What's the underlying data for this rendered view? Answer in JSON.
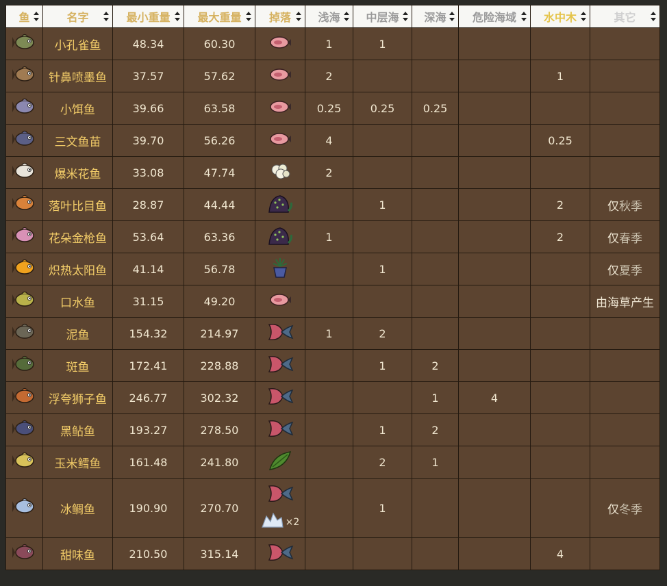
{
  "colors": {
    "row_bg": "#5c4430",
    "header_bg": "#f7f7f4",
    "name_text": "#f2cc68",
    "grid": "#241a10"
  },
  "headers": [
    {
      "label": "鱼"
    },
    {
      "label": "名字"
    },
    {
      "label": "最小重量"
    },
    {
      "label": "最大重量"
    },
    {
      "label": "掉落"
    },
    {
      "label": "浅海"
    },
    {
      "label": "中层海"
    },
    {
      "label": "深海"
    },
    {
      "label": "危险海域"
    },
    {
      "label": "水中木"
    },
    {
      "label": "其它"
    }
  ],
  "rows": [
    {
      "icon": "fish-icon",
      "fish_color": "#7d8a55",
      "name": "小孔雀鱼",
      "min": "48.34",
      "max": "60.30",
      "loot": "small-meat-icon",
      "loot_extra": "",
      "shallow": "1",
      "mid": "1",
      "deep": "",
      "danger": "",
      "tree": "",
      "note_a": "",
      "note_b": ""
    },
    {
      "icon": "fish-icon",
      "fish_color": "#a07b52",
      "name": "针鼻喷墨鱼",
      "min": "37.57",
      "max": "57.62",
      "loot": "small-meat-icon",
      "loot_extra": "",
      "shallow": "2",
      "mid": "",
      "deep": "",
      "danger": "",
      "tree": "1",
      "note_a": "",
      "note_b": ""
    },
    {
      "icon": "fish-icon",
      "fish_color": "#8b88b0",
      "name": "小饵鱼",
      "min": "39.66",
      "max": "63.58",
      "loot": "small-meat-icon",
      "loot_extra": "",
      "shallow": "0.25",
      "mid": "0.25",
      "deep": "0.25",
      "danger": "",
      "tree": "",
      "note_a": "",
      "note_b": ""
    },
    {
      "icon": "fish-icon",
      "fish_color": "#5b5f86",
      "name": "三文鱼苗",
      "min": "39.70",
      "max": "56.26",
      "loot": "small-meat-icon",
      "loot_extra": "",
      "shallow": "4",
      "mid": "",
      "deep": "",
      "danger": "",
      "tree": "0.25",
      "note_a": "",
      "note_b": ""
    },
    {
      "icon": "fish-icon",
      "fish_color": "#e8e4da",
      "name": "爆米花鱼",
      "min": "33.08",
      "max": "47.74",
      "loot": "popcorn-icon",
      "loot_extra": "",
      "shallow": "2",
      "mid": "",
      "deep": "",
      "danger": "",
      "tree": "",
      "note_a": "",
      "note_b": ""
    },
    {
      "icon": "fish-icon",
      "fish_color": "#d9823a",
      "name": "落叶比目鱼",
      "min": "28.87",
      "max": "44.44",
      "loot": "berry-bush-icon",
      "loot_extra": "",
      "shallow": "",
      "mid": "1",
      "deep": "",
      "danger": "",
      "tree": "2",
      "note_a": "仅",
      "note_b": "秋季"
    },
    {
      "icon": "fish-icon",
      "fish_color": "#d891b6",
      "name": "花朵金枪鱼",
      "min": "53.64",
      "max": "63.36",
      "loot": "berry-bush-icon",
      "loot_extra": "",
      "shallow": "1",
      "mid": "",
      "deep": "",
      "danger": "",
      "tree": "2",
      "note_a": "仅",
      "note_b": "春季"
    },
    {
      "icon": "fish-icon",
      "fish_color": "#f0a21e",
      "name": "炽热太阳鱼",
      "min": "41.14",
      "max": "56.78",
      "loot": "potted-plant-icon",
      "loot_extra": "",
      "shallow": "",
      "mid": "1",
      "deep": "",
      "danger": "",
      "tree": "",
      "note_a": "仅",
      "note_b": "夏季"
    },
    {
      "icon": "fish-icon",
      "fish_color": "#b9b24a",
      "name": "口水鱼",
      "min": "31.15",
      "max": "49.20",
      "loot": "small-meat-icon",
      "loot_extra": "",
      "shallow": "",
      "mid": "",
      "deep": "",
      "danger": "",
      "tree": "",
      "note_a": "由海草产生",
      "note_b": ""
    },
    {
      "icon": "fish-icon",
      "fish_color": "#6b6656",
      "name": "泥鱼",
      "min": "154.32",
      "max": "214.97",
      "loot": "fish-meat-icon",
      "loot_extra": "",
      "shallow": "1",
      "mid": "2",
      "deep": "",
      "danger": "",
      "tree": "",
      "note_a": "",
      "note_b": ""
    },
    {
      "icon": "fish-icon",
      "fish_color": "#556b3a",
      "name": "斑鱼",
      "min": "172.41",
      "max": "228.88",
      "loot": "fish-meat-icon",
      "loot_extra": "",
      "shallow": "",
      "mid": "1",
      "deep": "2",
      "danger": "",
      "tree": "",
      "note_a": "",
      "note_b": ""
    },
    {
      "icon": "fish-icon",
      "fish_color": "#c46a32",
      "name": "浮夸狮子鱼",
      "min": "246.77",
      "max": "302.32",
      "loot": "fish-meat-icon",
      "loot_extra": "",
      "shallow": "",
      "mid": "",
      "deep": "1",
      "danger": "4",
      "tree": "",
      "note_a": "",
      "note_b": ""
    },
    {
      "icon": "fish-icon",
      "fish_color": "#4a4f7a",
      "name": "黑鲇鱼",
      "min": "193.27",
      "max": "278.50",
      "loot": "fish-meat-icon",
      "loot_extra": "",
      "shallow": "",
      "mid": "1",
      "deep": "2",
      "danger": "",
      "tree": "",
      "note_a": "",
      "note_b": ""
    },
    {
      "icon": "fish-icon",
      "fish_color": "#d8c25a",
      "name": "玉米鳕鱼",
      "min": "161.48",
      "max": "241.80",
      "loot": "corn-icon",
      "loot_extra": "",
      "shallow": "",
      "mid": "2",
      "deep": "1",
      "danger": "",
      "tree": "",
      "note_a": "",
      "note_b": ""
    },
    {
      "icon": "fish-icon",
      "fish_color": "#a8bfe0",
      "name": "冰鲷鱼",
      "min": "190.90",
      "max": "270.70",
      "loot": "fish-meat-icon",
      "loot_extra": "ice-icon",
      "loot_extra_count": "×2",
      "shallow": "",
      "mid": "1",
      "deep": "",
      "danger": "",
      "tree": "",
      "note_a": "仅",
      "note_b": "冬季"
    },
    {
      "icon": "fish-icon",
      "fish_color": "#8a4a5a",
      "name": "甜味鱼",
      "min": "210.50",
      "max": "315.14",
      "loot": "fish-meat-icon",
      "loot_extra": "",
      "shallow": "",
      "mid": "",
      "deep": "",
      "danger": "",
      "tree": "4",
      "note_a": "",
      "note_b": ""
    }
  ]
}
